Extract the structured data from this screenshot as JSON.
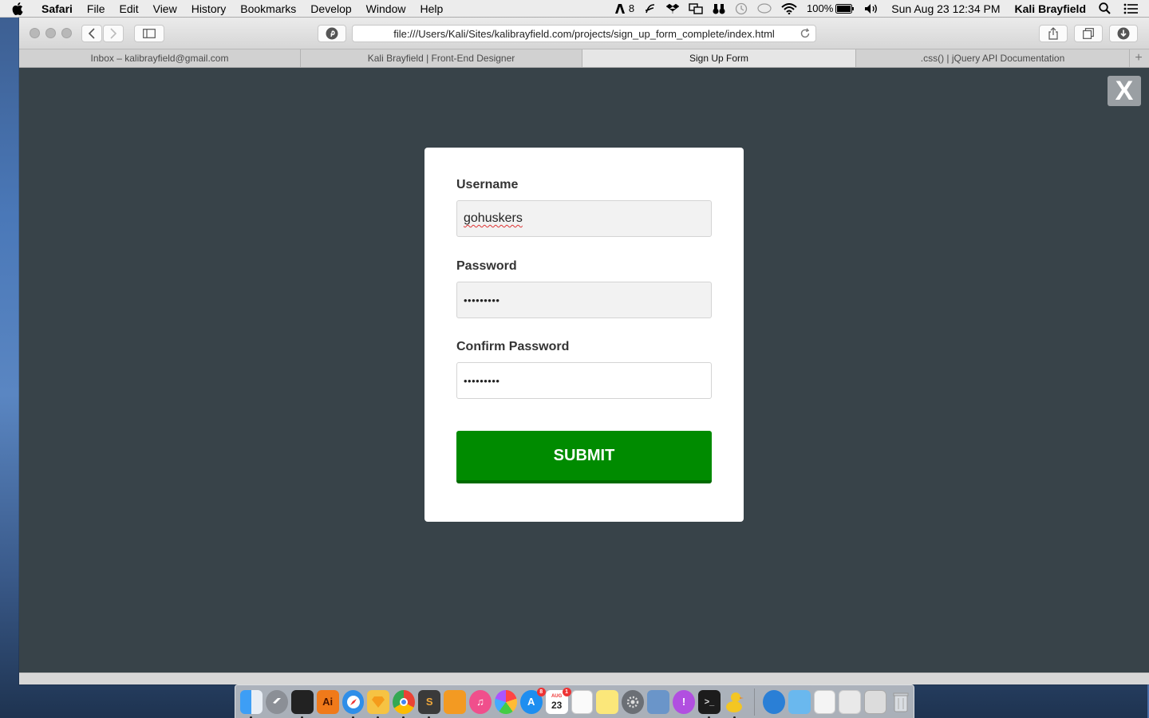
{
  "menubar": {
    "app_name": "Safari",
    "items": [
      "File",
      "Edit",
      "View",
      "History",
      "Bookmarks",
      "Develop",
      "Window",
      "Help"
    ],
    "status": {
      "adobe_count": "8",
      "battery": "100%",
      "datetime": "Sun Aug 23  12:34 PM",
      "user": "Kali Brayfield"
    }
  },
  "browser": {
    "url": "file:///Users/Kali/Sites/kalibrayfield.com/projects/sign_up_form_complete/index.html",
    "tabs": [
      {
        "label": "Inbox – kalibrayfield@gmail.com",
        "active": false
      },
      {
        "label": "Kali Brayfield | Front-End Designer",
        "active": false
      },
      {
        "label": "Sign Up Form",
        "active": true
      },
      {
        "label": ".css() | jQuery API Documentation",
        "active": false
      }
    ],
    "new_tab": "+"
  },
  "page": {
    "close_label": "X",
    "form": {
      "username_label": "Username",
      "username_value": "gohuskers",
      "password_label": "Password",
      "password_value": "•••••••••",
      "confirm_label": "Confirm Password",
      "confirm_value": "•••••••••",
      "submit_label": "SUBMIT"
    }
  },
  "dock": {
    "calendar_day": "23",
    "calendar_month": "AUG",
    "appstore_badge": "8",
    "calendar_badge": "1"
  },
  "colors": {
    "page_bg": "#384349",
    "submit_green": "#008b00",
    "close_btn": "#9a9fa3"
  }
}
